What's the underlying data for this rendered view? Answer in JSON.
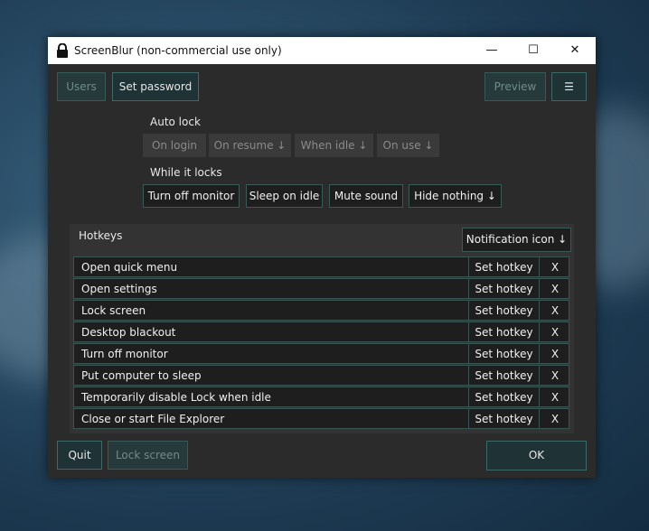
{
  "window": {
    "title": "ScreenBlur (non-commercial use only)",
    "controls": {
      "minimize": "—",
      "maximize": "☐",
      "close": "✕"
    }
  },
  "toolbar": {
    "users_label": "Users",
    "set_password_label": "Set password",
    "preview_label": "Preview",
    "menu_label": "☰"
  },
  "auto_lock": {
    "heading": "Auto lock",
    "options": [
      "On login",
      "On resume ↓",
      "When idle ↓",
      "On use ↓"
    ]
  },
  "while_locks": {
    "heading": "While it locks",
    "options": [
      "Turn off monitor",
      "Sleep on idle",
      "Mute sound",
      "Hide nothing ↓"
    ]
  },
  "hotkeys": {
    "heading": "Hotkeys",
    "notification_label": "Notification icon ↓",
    "set_hotkey_label": "Set hotkey",
    "remove_label": "X",
    "rows": [
      "Open quick menu",
      "Open settings",
      "Lock screen",
      "Desktop blackout",
      "Turn off monitor",
      "Put computer to sleep",
      "Temporarily disable Lock when idle",
      "Close or start File Explorer"
    ]
  },
  "footer": {
    "quit_label": "Quit",
    "lock_screen_label": "Lock screen",
    "ok_label": "OK"
  },
  "colors": {
    "accent_border": "#3b6a68",
    "accent_fill": "#1f3336",
    "window_bg": "#2b2b2b"
  }
}
